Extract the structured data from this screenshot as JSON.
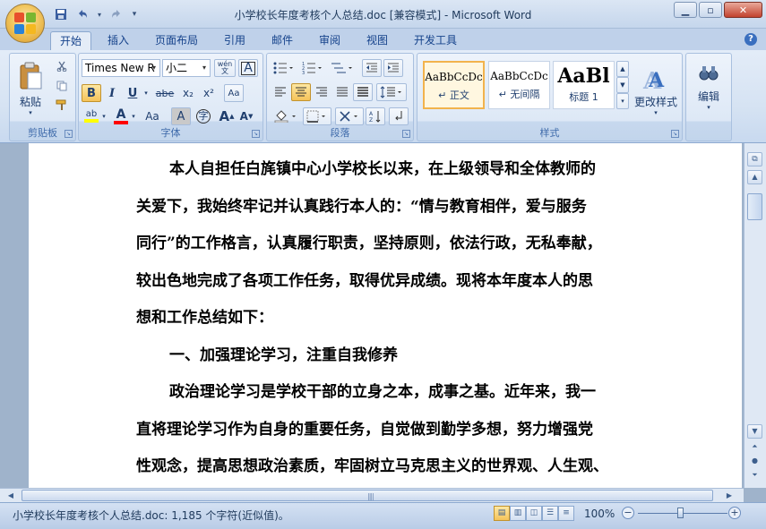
{
  "window": {
    "title": "小学校长年度考核个人总结.doc [兼容模式] - Microsoft Word"
  },
  "qat": {
    "save_icon": "save-icon",
    "undo_icon": "undo-icon",
    "redo_icon": "redo-icon",
    "customize_icon": "chevron-down-icon"
  },
  "tabs": [
    {
      "label": "开始",
      "active": true
    },
    {
      "label": "插入"
    },
    {
      "label": "页面布局"
    },
    {
      "label": "引用"
    },
    {
      "label": "邮件"
    },
    {
      "label": "审阅"
    },
    {
      "label": "视图"
    },
    {
      "label": "开发工具"
    }
  ],
  "ribbon": {
    "clipboard": {
      "label": "剪贴板",
      "paste": "粘贴"
    },
    "font": {
      "label": "字体",
      "font_name": "Times New R",
      "font_size": "小二",
      "wen": "wén\n文",
      "A_box": "A",
      "bold": "B",
      "italic": "I",
      "underline": "U",
      "strike": "abe",
      "sub": "x₂",
      "sup": "x²",
      "clear": "Aa",
      "highlight": "ab",
      "fontcolor": "A",
      "changecase": "Aa",
      "shade": "A",
      "enclose": "字",
      "grow": "A",
      "shrink": "A"
    },
    "paragraph": {
      "label": "段落"
    },
    "styles": {
      "label": "样式",
      "items": [
        {
          "sample": "AaBbCcDc",
          "name": "↵ 正文",
          "selected": true
        },
        {
          "sample": "AaBbCcDc",
          "name": "↵ 无间隔"
        },
        {
          "sample": "AaBl",
          "name": "标题 1"
        }
      ],
      "change": "更改样式"
    },
    "editing": {
      "label": "编辑"
    }
  },
  "document": {
    "lines": [
      {
        "text": "本人自担任白旄镇中心小学校长以来，在上级领导和全体教师的",
        "indent": true
      },
      {
        "text": "关爱下，我始终牢记并认真践行本人的：“情与教育相伴，爱与服务"
      },
      {
        "text": "同行”的工作格言，认真履行职责，坚持原则，依法行政，无私奉献，"
      },
      {
        "text": "较出色地完成了各项工作任务，取得优异成绩。现将本年度本人的思"
      },
      {
        "text": "想和工作总结如下："
      },
      {
        "text": "一、加强理论学习，注重自我修养",
        "indent": true
      },
      {
        "text": "政治理论学习是学校干部的立身之本，成事之基。近年来，我一",
        "indent": true
      },
      {
        "text": "直将理论学习作为自身的重要任务，自觉做到勤学多想，努力增强党"
      },
      {
        "text": "性观念，提高思想政治素质，牢固树立马克思主义的世界观、人生观、"
      }
    ]
  },
  "statusbar": {
    "text": "小学校长年度考核个人总结.doc: 1,185 个字符(近似值)。",
    "zoom": "100%",
    "zoom_minus": "−",
    "zoom_plus": "+"
  },
  "colors": {
    "accent": "#15428b",
    "highlight": "#ffff00",
    "font_color": "#ff0000"
  }
}
